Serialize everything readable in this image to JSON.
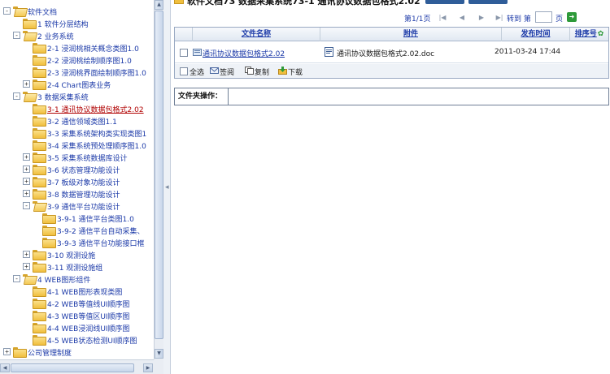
{
  "tree": {
    "nodes": [
      {
        "label": "软件文档",
        "level": 0,
        "toggle": "-",
        "open": true,
        "selected": false
      },
      {
        "label": "1 软件分层结构",
        "level": 1,
        "toggle": "",
        "open": false,
        "selected": false
      },
      {
        "label": "2 业务系统",
        "level": 1,
        "toggle": "-",
        "open": true,
        "selected": false
      },
      {
        "label": "2-1 浸润桃相关概念类图1.0",
        "level": 2,
        "toggle": "",
        "open": false,
        "selected": false
      },
      {
        "label": "2-2 浸润桃绘制顺序图1.0",
        "level": 2,
        "toggle": "",
        "open": false,
        "selected": false
      },
      {
        "label": "2-3 浸润桃界面绘制顺序图1.0",
        "level": 2,
        "toggle": "",
        "open": false,
        "selected": false
      },
      {
        "label": "2-4 Chart图表业务",
        "level": 2,
        "toggle": "+",
        "open": false,
        "selected": false
      },
      {
        "label": "3 数据采集系统",
        "level": 1,
        "toggle": "-",
        "open": true,
        "selected": false
      },
      {
        "label": "3-1 通讯协议数据包格式2.02",
        "level": 2,
        "toggle": "",
        "open": false,
        "selected": true
      },
      {
        "label": "3-2 通信领域类图1.1",
        "level": 2,
        "toggle": "",
        "open": false,
        "selected": false
      },
      {
        "label": "3-3 采集系统架构类实现类图1",
        "level": 2,
        "toggle": "",
        "open": false,
        "selected": false
      },
      {
        "label": "3-4 采集系统预处理顺序图1.0",
        "level": 2,
        "toggle": "",
        "open": false,
        "selected": false
      },
      {
        "label": "3-5 采集系统数据库设计",
        "level": 2,
        "toggle": "+",
        "open": false,
        "selected": false
      },
      {
        "label": "3-6 状态管理功能设计",
        "level": 2,
        "toggle": "+",
        "open": false,
        "selected": false
      },
      {
        "label": "3-7 板级对象功能设计",
        "level": 2,
        "toggle": "+",
        "open": false,
        "selected": false
      },
      {
        "label": "3-8 数据管理功能设计",
        "level": 2,
        "toggle": "+",
        "open": false,
        "selected": false
      },
      {
        "label": "3-9 通信平台功能设计",
        "level": 2,
        "toggle": "-",
        "open": true,
        "selected": false
      },
      {
        "label": "3-9-1 通信平台类图1.0",
        "level": 3,
        "toggle": "",
        "open": false,
        "selected": false
      },
      {
        "label": "3-9-2 通信平台自动采集、",
        "level": 3,
        "toggle": "",
        "open": false,
        "selected": false
      },
      {
        "label": "3-9-3 通信平台功能接口框",
        "level": 3,
        "toggle": "",
        "open": false,
        "selected": false
      },
      {
        "label": "3-10 观测设施",
        "level": 2,
        "toggle": "+",
        "open": false,
        "selected": false
      },
      {
        "label": "3-11 观测设施组",
        "level": 2,
        "toggle": "+",
        "open": false,
        "selected": false
      },
      {
        "label": "4 WEB图形组件",
        "level": 1,
        "toggle": "-",
        "open": true,
        "selected": false
      },
      {
        "label": "4-1 WEB图形表现类图",
        "level": 2,
        "toggle": "",
        "open": false,
        "selected": false
      },
      {
        "label": "4-2 WEB等值线UI顺序图",
        "level": 2,
        "toggle": "",
        "open": false,
        "selected": false
      },
      {
        "label": "4-3 WEB等值区UI顺序图",
        "level": 2,
        "toggle": "",
        "open": false,
        "selected": false
      },
      {
        "label": "4-4 WEB浸润线UI顺序图",
        "level": 2,
        "toggle": "",
        "open": false,
        "selected": false
      },
      {
        "label": "4-5 WEB状态检测UI顺序图",
        "level": 2,
        "toggle": "",
        "open": false,
        "selected": false
      },
      {
        "label": "公司管理制度",
        "level": 0,
        "toggle": "+",
        "open": false,
        "selected": false
      }
    ]
  },
  "header": {
    "title": "软件文档73 数据采集系统73-1 通讯协议数据包格式2.02"
  },
  "pager": {
    "page_info": "第1/1页",
    "goto_label": "转到 第",
    "goto_value": "",
    "page_unit": "页",
    "first_icon": "first-page-icon",
    "prev_icon": "prev-page-icon",
    "next_icon": "next-page-icon",
    "last_icon": "last-page-icon"
  },
  "grid": {
    "columns": [
      "文件名称",
      "附件",
      "发布时间",
      "排序号"
    ],
    "sort_icon": "sort-up-icon",
    "rows": [
      {
        "name": "通讯协议数据包格式2.02",
        "attachment": "通讯协议数据包格式2.02.doc",
        "time": "2011-03-24 17:44"
      }
    ],
    "actions": {
      "select_all": "全选",
      "review": "签阅",
      "copy": "复制",
      "download": "下载"
    }
  },
  "folder_ops": {
    "label": "文件夹操作："
  },
  "colors": {
    "link": "#1c3aa8",
    "selected": "#b00000",
    "folder": "#f0bf3e",
    "header_button": "#2f5d99",
    "go_button": "#2e9a3a"
  }
}
